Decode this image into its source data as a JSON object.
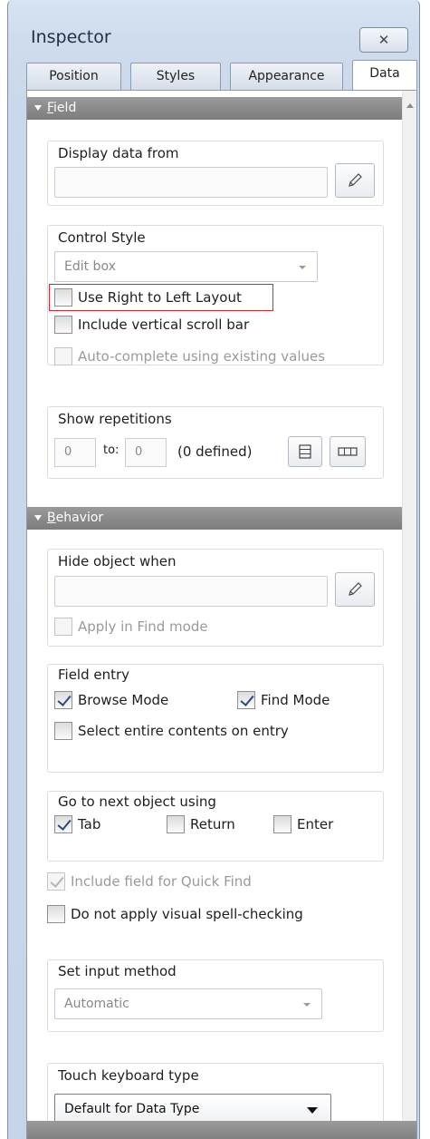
{
  "window": {
    "title": "Inspector",
    "close_glyph": "✕"
  },
  "tabs": [
    {
      "label": "Position",
      "active": false
    },
    {
      "label": "Styles",
      "active": false
    },
    {
      "label": "Appearance",
      "active": false
    },
    {
      "label": "Data",
      "active": true
    }
  ],
  "field_section": {
    "header_first": "F",
    "header_rest": "ield",
    "display_data_from": {
      "label": "Display data from",
      "value": ""
    },
    "control_style": {
      "label": "Control Style",
      "selected": "Edit box",
      "use_right_to_left": {
        "label": "Use Right to Left Layout",
        "checked": false
      },
      "include_vertical_scroll_bar": {
        "label": "Include vertical scroll bar",
        "checked": false
      },
      "auto_complete": {
        "label": "Auto-complete using existing values",
        "checked": false,
        "enabled": false
      }
    },
    "show_repetitions": {
      "label": "Show repetitions",
      "from": "0",
      "to_label": "to:",
      "to": "0",
      "defined_text": "(0 defined)"
    }
  },
  "behavior_section": {
    "header_first": "B",
    "header_rest": "ehavior",
    "hide_object_when": {
      "label": "Hide object when",
      "value": "",
      "apply_in_find_mode": {
        "label": "Apply in Find mode",
        "checked": false,
        "enabled": false
      }
    },
    "field_entry": {
      "label": "Field entry",
      "browse_mode": {
        "label": "Browse Mode",
        "checked": true
      },
      "find_mode": {
        "label": "Find Mode",
        "checked": true
      },
      "select_entire_contents": {
        "label": "Select entire contents on entry",
        "checked": false
      }
    },
    "go_to_next_object": {
      "label": "Go to next object using",
      "tab": {
        "label": "Tab",
        "checked": true
      },
      "return": {
        "label": "Return",
        "checked": false
      },
      "enter": {
        "label": "Enter",
        "checked": false
      }
    },
    "include_field_quick_find": {
      "label": "Include field for Quick Find",
      "checked": true,
      "enabled": false
    },
    "do_not_apply_spell_check": {
      "label": "Do not apply visual spell-checking",
      "checked": false
    },
    "set_input_method": {
      "label": "Set input method",
      "selected": "Automatic"
    },
    "touch_keyboard_type": {
      "label": "Touch keyboard type",
      "selected": "Default for Data Type"
    }
  },
  "colors": {
    "highlight_border": "#d9282f",
    "section_header": "#8a8a8a",
    "window_frame": "#c9d8ea"
  }
}
